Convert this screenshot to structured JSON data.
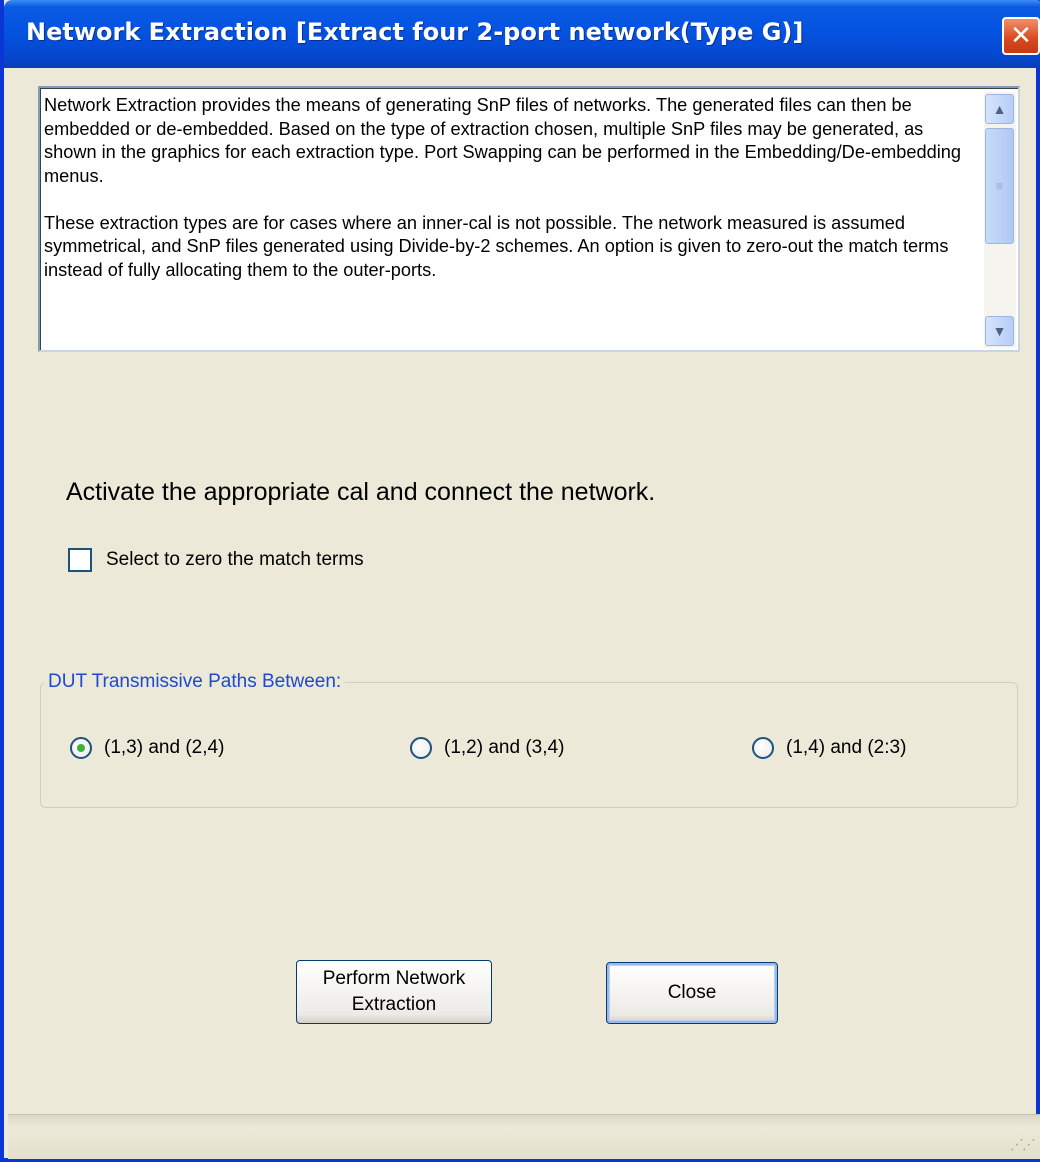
{
  "window": {
    "title": "Network Extraction [Extract four 2-port network(Type G)]",
    "close_glyph": "✕"
  },
  "description": {
    "paragraph1": "Network Extraction provides the means of generating SnP files of networks.  The generated files can then be embedded or de-embedded.  Based on the type of extraction chosen, multiple SnP files may be generated, as shown in the graphics for each extraction type.  Port Swapping can be performed in the Embedding/De-embedding menus.",
    "paragraph2": "These extraction types are for cases where an inner-cal is not possible.  The network measured is assumed symmetrical, and  SnP files generated using Divide-by-2 schemes.  An option is given to zero-out the match terms instead of fully allocating them to the outer-ports."
  },
  "instruction": "Activate the appropriate cal and connect the network.",
  "zero_match": {
    "label": "Select to zero the match terms",
    "checked": false
  },
  "paths_group": {
    "legend": "DUT Transmissive Paths Between:",
    "options": [
      {
        "label": "(1,3) and (2,4)",
        "selected": true
      },
      {
        "label": "(1,2) and (3,4)",
        "selected": false
      },
      {
        "label": "(1,4) and (2:3)",
        "selected": false
      }
    ]
  },
  "buttons": {
    "perform": "Perform Network Extraction",
    "close": "Close"
  },
  "icons": {
    "scroll_up": "scroll-up-arrow-icon",
    "scroll_down": "scroll-down-arrow-icon",
    "size_grip": "resize-grip-icon"
  },
  "colors": {
    "titlebar": "#0553e1",
    "window_bg": "#ece9d8",
    "group_legend": "#1f49d1",
    "close_button": "#d9471e"
  }
}
